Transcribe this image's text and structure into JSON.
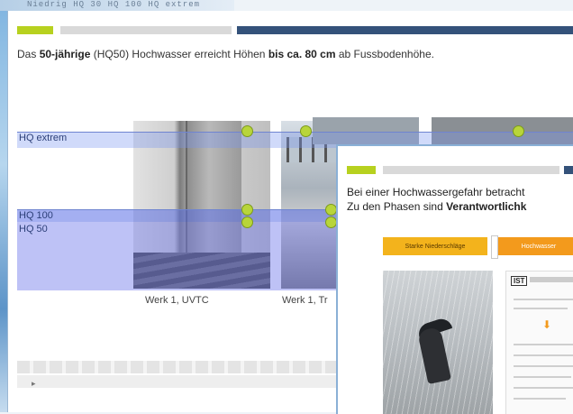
{
  "background": {
    "top_text": "Niedrig  HQ 30  HQ 100  HQ extrem"
  },
  "main": {
    "intro": {
      "part1": "Das ",
      "bold1": "50-jährige",
      "part2": " (HQ50) Hochwasser erreicht Höhen ",
      "bold2": "bis ca. 80 cm",
      "part3": " ab Fussbodenhöhe."
    },
    "levels": [
      {
        "label": "HQ extrem"
      },
      {
        "label": "HQ 100"
      },
      {
        "label": "HQ 50"
      }
    ],
    "captions": [
      "Werk 1, UVTC",
      "Werk 1, Tr"
    ],
    "pager_mark": "▸"
  },
  "overlay": {
    "line1": "Bei einer Hochwassergefahr betracht",
    "line2_normal": "Zu den Phasen sind ",
    "line2_bold": "Verantwortlichk",
    "phases": [
      "Starke Niederschläge",
      "Hochwasser"
    ],
    "doc_logo": "IST"
  },
  "colors": {
    "accent_green": "#b7d11f",
    "header_blue": "#34527a",
    "flood_band": "#6e78eb",
    "phase1": "#f3b31c",
    "phase2": "#f39a1c"
  }
}
